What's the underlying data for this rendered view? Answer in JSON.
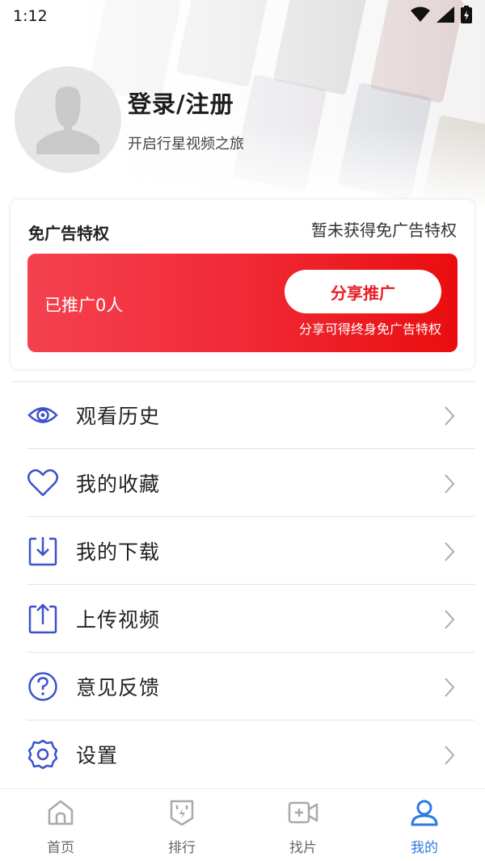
{
  "status_bar": {
    "time": "1:12"
  },
  "profile": {
    "title": "登录/注册",
    "subtitle": "开启行星视频之旅"
  },
  "vip": {
    "title": "免广告特权",
    "status": "暂未获得免广告特权",
    "promo_count": "已推广0人",
    "share_button": "分享推广",
    "share_note": "分享可得终身免广告特权"
  },
  "menu": [
    {
      "label": "观看历史",
      "icon": "eye-icon"
    },
    {
      "label": "我的收藏",
      "icon": "heart-icon"
    },
    {
      "label": "我的下载",
      "icon": "download-icon"
    },
    {
      "label": "上传视频",
      "icon": "upload-icon"
    },
    {
      "label": "意见反馈",
      "icon": "question-icon"
    },
    {
      "label": "设置",
      "icon": "gear-icon"
    }
  ],
  "tabs": [
    {
      "label": "首页",
      "icon": "home-icon"
    },
    {
      "label": "排行",
      "icon": "ranking-icon"
    },
    {
      "label": "找片",
      "icon": "video-camera-icon"
    },
    {
      "label": "我的",
      "icon": "user-icon",
      "active": true
    }
  ],
  "colors": {
    "accent_red": "#ea1c24",
    "icon_blue": "#3d52c9",
    "active_tab": "#2b7be0"
  }
}
